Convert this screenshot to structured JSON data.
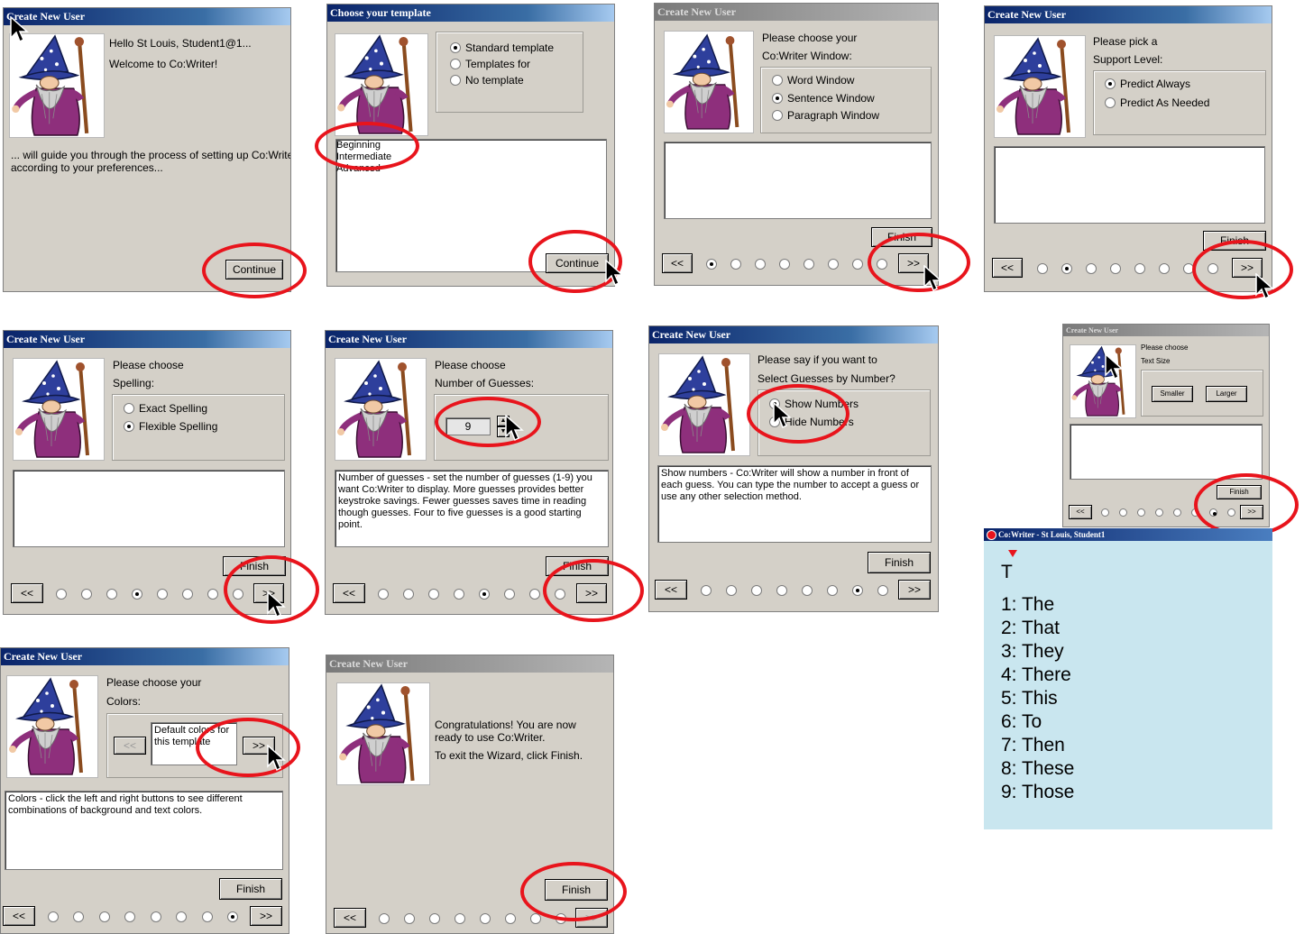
{
  "dialogs": {
    "d1": {
      "title": "Create New User",
      "line1": "Hello St Louis, Student1@1...",
      "line2": "Welcome to Co:Writer!",
      "body1": "... will guide you through the process of setting up Co:Writer",
      "body2": "according to your preferences...",
      "continue": "Continue"
    },
    "d2": {
      "title": "Choose your template",
      "opt1": "Standard template",
      "opt2": "Templates for",
      "opt3": "No template",
      "list": [
        "Beginning",
        "Intermediate",
        "Advanced"
      ],
      "continue": "Continue"
    },
    "d3": {
      "title": "Create New User",
      "q1": "Please choose your",
      "q2": "Co:Writer Window:",
      "opt1": "Word Window",
      "opt2": "Sentence Window",
      "opt3": "Paragraph Window",
      "finish": "Finish",
      "prev": "<<",
      "next": ">>"
    },
    "d4": {
      "title": "Create New User",
      "q1": "Please pick a",
      "q2": "Support Level:",
      "opt1": "Predict Always",
      "opt2": "Predict As Needed",
      "finish": "Finish",
      "prev": "<<",
      "next": ">>"
    },
    "d5": {
      "title": "Create New User",
      "q1": "Please choose",
      "q2": "Spelling:",
      "opt1": "Exact Spelling",
      "opt2": "Flexible Spelling",
      "finish": "Finish",
      "prev": "<<",
      "next": ">>"
    },
    "d6": {
      "title": "Create New User",
      "q1": "Please choose",
      "q2": "Number of Guesses:",
      "value": "9",
      "desc": "Number of guesses - set the number of guesses (1-9) you want Co:Writer to display. More guesses provides better keystroke savings. Fewer guesses saves time in reading though guesses. Four to five guesses is a good starting point.",
      "finish": "Finish",
      "prev": "<<",
      "next": ">>"
    },
    "d7": {
      "title": "Create New User",
      "q1": "Please say if you want to",
      "q2": "Select Guesses by Number?",
      "opt1": "Show Numbers",
      "opt2": "Hide Numbers",
      "desc": "Show numbers - Co:Writer will show a number in front of each guess. You can type the number to accept a guess or use any other selection method.",
      "finish": "Finish",
      "prev": "<<",
      "next": ">>"
    },
    "d8": {
      "title": "Create New User",
      "q1": "Please choose",
      "q2": "Text Size",
      "smaller": "Smaller",
      "larger": "Larger",
      "finish": "Finish",
      "prev": "<<",
      "next": ">>"
    },
    "d9": {
      "title": "Create New User",
      "q1": "Please choose your",
      "q2": "Colors:",
      "swatch": "Default colors for this template",
      "desc": "Colors - click the left and right buttons to see different combinations of background and text colors.",
      "finish": "Finish",
      "prev": "<<",
      "next": ">>"
    },
    "d10": {
      "title": "Create New User",
      "msg1": "Congratulations! You are now ready to use Co:Writer.",
      "msg2": "To exit the Wizard, click Finish.",
      "finish": "Finish",
      "prev": "<<",
      "next": ">>"
    }
  },
  "cowriter": {
    "title": "Co:Writer - St Louis, Student1",
    "typed": "T",
    "predictions": [
      "1: The",
      "2: That",
      "3: They",
      "4: There",
      "5: This",
      "6: To",
      "7: Then",
      "8: These",
      "9: Those"
    ]
  },
  "colors": {
    "highlight_ring": "#e8141c",
    "titlebar": "#0a246a",
    "panel": "#c9e6ef"
  }
}
